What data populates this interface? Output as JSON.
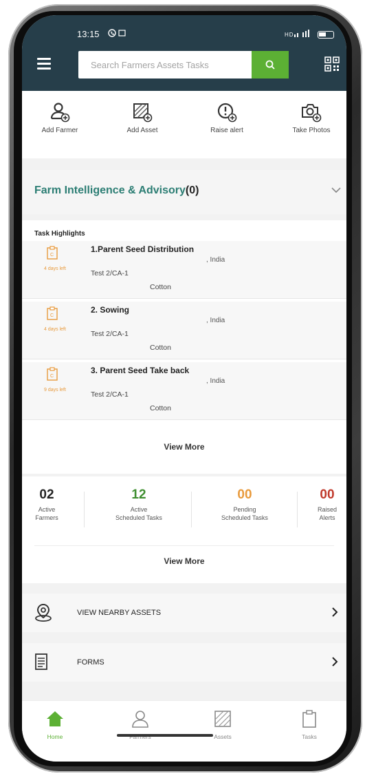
{
  "status_bar": {
    "time": "13:15",
    "whatsapp_icon": "whatsapp-icon",
    "signal": "ᴴ⁺ₗ.ıl"
  },
  "header": {
    "search_placeholder": "Search Farmers Assets Tasks",
    "accent": "#5cb034",
    "bar_color": "#263e4a"
  },
  "quick_actions": [
    {
      "label": "Add Farmer",
      "icon": "add-farmer-icon"
    },
    {
      "label": "Add Asset",
      "icon": "add-asset-icon"
    },
    {
      "label": "Raise alert",
      "icon": "raise-alert-icon"
    },
    {
      "label": "Take Photos",
      "icon": "take-photos-icon"
    }
  ],
  "advisory": {
    "title": "Farm Intelligence & Advisory",
    "count": "(0)"
  },
  "task_highlights": {
    "header": "Task Highlights",
    "tasks": [
      {
        "name": "1.Parent Seed Distribution",
        "location": ", India",
        "days_left": "4 days left",
        "code": "Test 2/CA-1",
        "crop": "Cotton"
      },
      {
        "name": "2. Sowing",
        "location": ", India",
        "days_left": "4 days left",
        "code": "Test 2/CA-1",
        "crop": "Cotton"
      },
      {
        "name": "3. Parent Seed Take back",
        "location": ", India",
        "days_left": "9 days left",
        "code": "Test 2/CA-1",
        "crop": "Cotton"
      }
    ],
    "view_more": "View More"
  },
  "stats": {
    "items": [
      {
        "value": "02",
        "line1": "Active",
        "line2": "Farmers",
        "color": "#222222"
      },
      {
        "value": "12",
        "line1": "Active",
        "line2": "Scheduled Tasks",
        "color": "#3e8e2f"
      },
      {
        "value": "00",
        "line1": "Pending",
        "line2": "Scheduled Tasks",
        "color": "#e89a3c"
      },
      {
        "value": "00",
        "line1": "Raised",
        "line2": "Alerts",
        "color": "#c0392b"
      }
    ],
    "view_more": "View More"
  },
  "links": [
    {
      "label": "VIEW NEARBY ASSETS",
      "icon": "map-pin-icon"
    },
    {
      "label": "FORMS",
      "icon": "form-icon"
    }
  ],
  "bottom_nav": [
    {
      "label": "Home",
      "icon": "home-icon",
      "active": true
    },
    {
      "label": "Farmers",
      "icon": "farmers-icon",
      "active": false
    },
    {
      "label": "Assets",
      "icon": "assets-icon",
      "active": false
    },
    {
      "label": "Tasks",
      "icon": "tasks-icon",
      "active": false
    }
  ]
}
